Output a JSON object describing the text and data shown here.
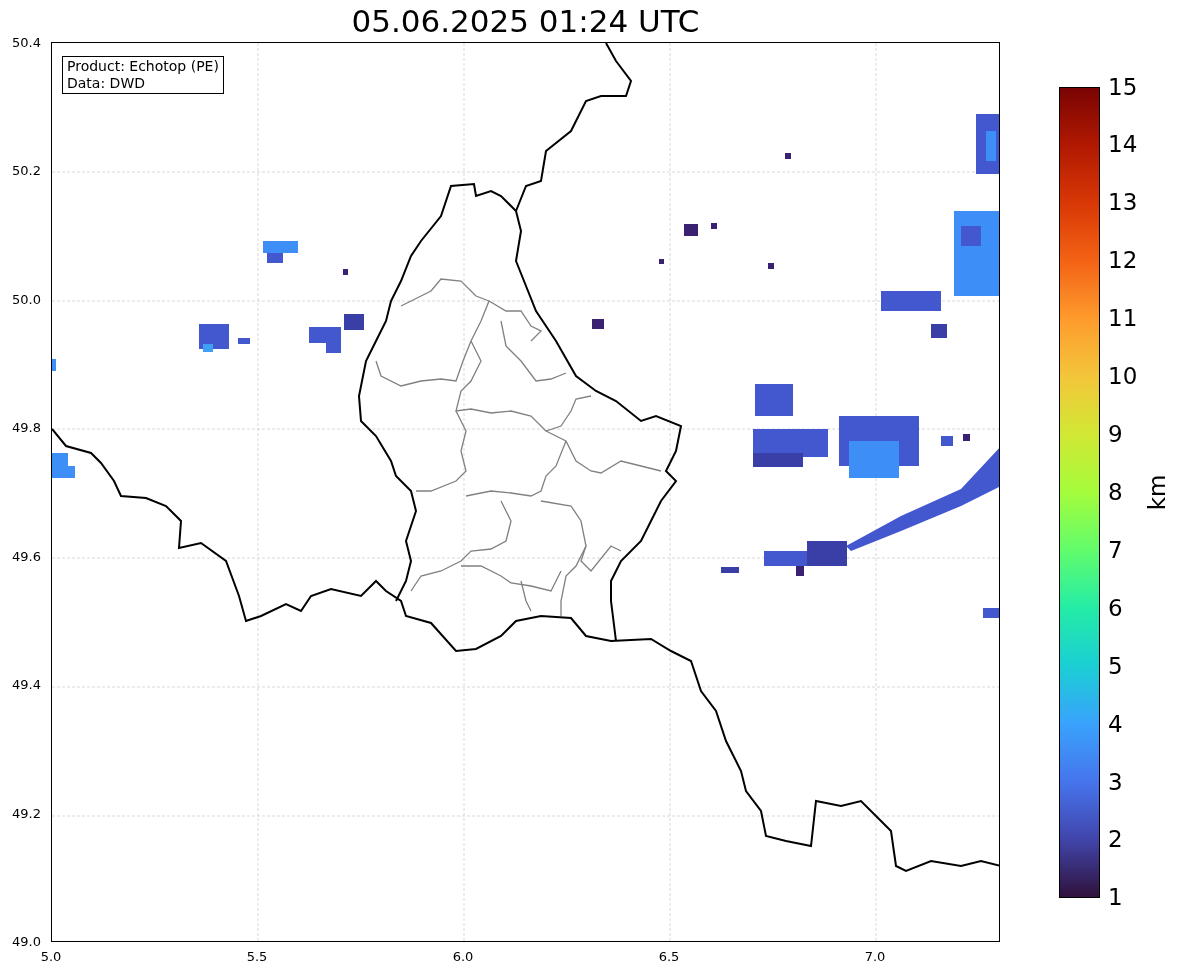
{
  "title": "05.06.2025 01:24 UTC",
  "info_box": {
    "lines": [
      "Product: Echotop (PE)",
      "Data: DWD"
    ]
  },
  "y_axis": {
    "ticks": [
      "50.4",
      "50.2",
      "50.0",
      "49.8",
      "49.6",
      "49.4",
      "49.2",
      "49.0"
    ]
  },
  "x_axis": {
    "ticks": [
      "5.0",
      "5.5",
      "6.0",
      "6.5",
      "7.0"
    ]
  },
  "colorbar": {
    "label": "km",
    "ticks": [
      "15",
      "14",
      "13",
      "12",
      "11",
      "10",
      "9",
      "8",
      "7",
      "6",
      "5",
      "4",
      "3",
      "2",
      "1"
    ]
  }
}
